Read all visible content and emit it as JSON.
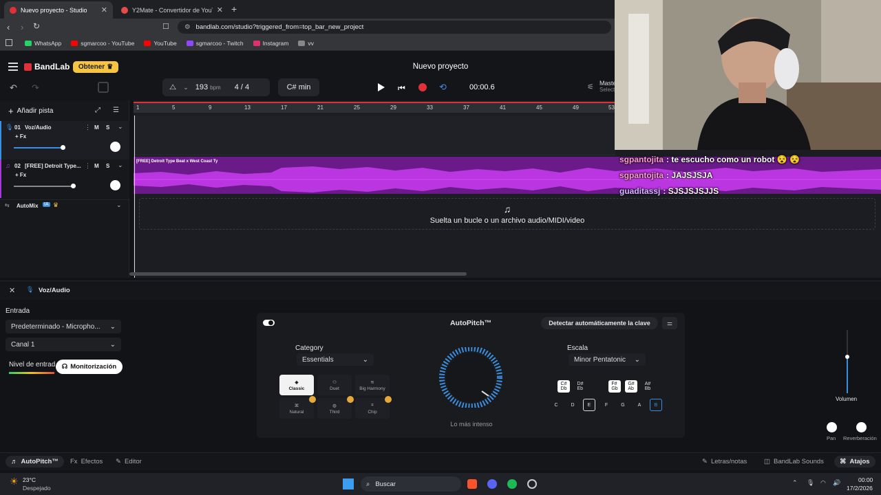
{
  "browser": {
    "tabs": [
      {
        "label": "Nuevo proyecto - Studio",
        "active": true
      },
      {
        "label": "Y2Mate - Convertidor de YouTube a",
        "active": false
      }
    ],
    "new_tab": "+",
    "url": "bandlab.com/studio?triggered_from=top_bar_new_project",
    "bookmarks": [
      {
        "label": "WhatsApp",
        "color": "#25d366"
      },
      {
        "label": "sgmarcoo - YouTube",
        "color": "#ff0000"
      },
      {
        "label": "YouTube",
        "color": "#ff0000"
      },
      {
        "label": "sgmarcoo - Twitch",
        "color": "#9146ff"
      },
      {
        "label": "Instagram",
        "color": "#e1306c"
      },
      {
        "label": "vv",
        "color": "#888888"
      }
    ]
  },
  "header": {
    "brand": "BandLab",
    "upgrade": "Obtener",
    "project_title": "Nuevo proyecto",
    "bpm_value": "193",
    "bpm_unit": "bpm",
    "time_sig": "4 / 4",
    "key": "C# min",
    "time": "00:00.6",
    "master": "Maste",
    "master_sub": "Select"
  },
  "tracks": {
    "add_track": "Añadir pista",
    "items": [
      {
        "number": "01",
        "name": "Voz/Audio",
        "fx": "+ Fx",
        "m": "M",
        "s": "S"
      },
      {
        "number": "02",
        "name": "[FREE] Detroit Type...",
        "fx": "+ Fx",
        "m": "M",
        "s": "S"
      }
    ],
    "automix": "AutoMix",
    "automix_badge": "IA"
  },
  "timeline": {
    "ruler": [
      "1",
      "5",
      "9",
      "13",
      "17",
      "21",
      "25",
      "29",
      "33",
      "37",
      "41",
      "45",
      "49",
      "53"
    ],
    "region_title": "[FREE] Detroit Type Beat x West Coast Ty",
    "drop_hint": "Suelta un bucle o un archivo audio/MIDI/video"
  },
  "editor": {
    "track_name": "Voz/Audio",
    "input_label": "Entrada",
    "input_device": "Predeterminado - Micropho...",
    "channel": "Canal 1",
    "level_label": "Nivel de entrad",
    "monitor": "Monitorización",
    "autopitch": {
      "title": "AutoPitch™",
      "detect": "Detectar automáticamente la clave",
      "category_label": "Category",
      "category_value": "Essentials",
      "styles": [
        {
          "label": "Classic",
          "selected": true
        },
        {
          "label": "Duet",
          "selected": false
        },
        {
          "label": "Big Harmony",
          "selected": false
        },
        {
          "label": "Natural",
          "selected": false
        },
        {
          "label": "Third",
          "selected": false
        },
        {
          "label": "Chip",
          "selected": false
        }
      ],
      "knob_label": "Lo más intenso",
      "scale_label": "Escala",
      "scale_value": "Minor Pentatonic",
      "sharps": [
        "C#\nDb",
        "D#\nEb",
        "F#\nGb",
        "G#\nAb",
        "A#\nBb"
      ],
      "naturals": [
        "C",
        "D",
        "E",
        "F",
        "G",
        "A",
        "B"
      ]
    },
    "volume": "Volumen",
    "pan": "Pan",
    "reverb": "Reverberación"
  },
  "bottom_tabs": {
    "autopitch": "AutoPitch™",
    "effects": "Efectos",
    "editor": "Editor",
    "lyrics": "Letras/notas",
    "sounds": "BandLab Sounds",
    "shortcuts": "Atajos"
  },
  "taskbar": {
    "weather_temp": "23°C",
    "weather_desc": "Despejado",
    "search": "Buscar",
    "clock_time": "00:00",
    "clock_date": "17/2/2026"
  },
  "chat": [
    {
      "user": "sgpantojita",
      "message": ": te escucho como un robot 😵 😵"
    },
    {
      "user": "sgpantojita",
      "message": ": JAJSJSJA"
    },
    {
      "user": "guaditassj",
      "message": ": SJSJSJSJJS"
    }
  ],
  "colors": {
    "accent_red": "#e0313a",
    "accent_yellow": "#f6c343",
    "region_purple": "#8a1fb8",
    "knob_blue": "#3b8fe0"
  }
}
